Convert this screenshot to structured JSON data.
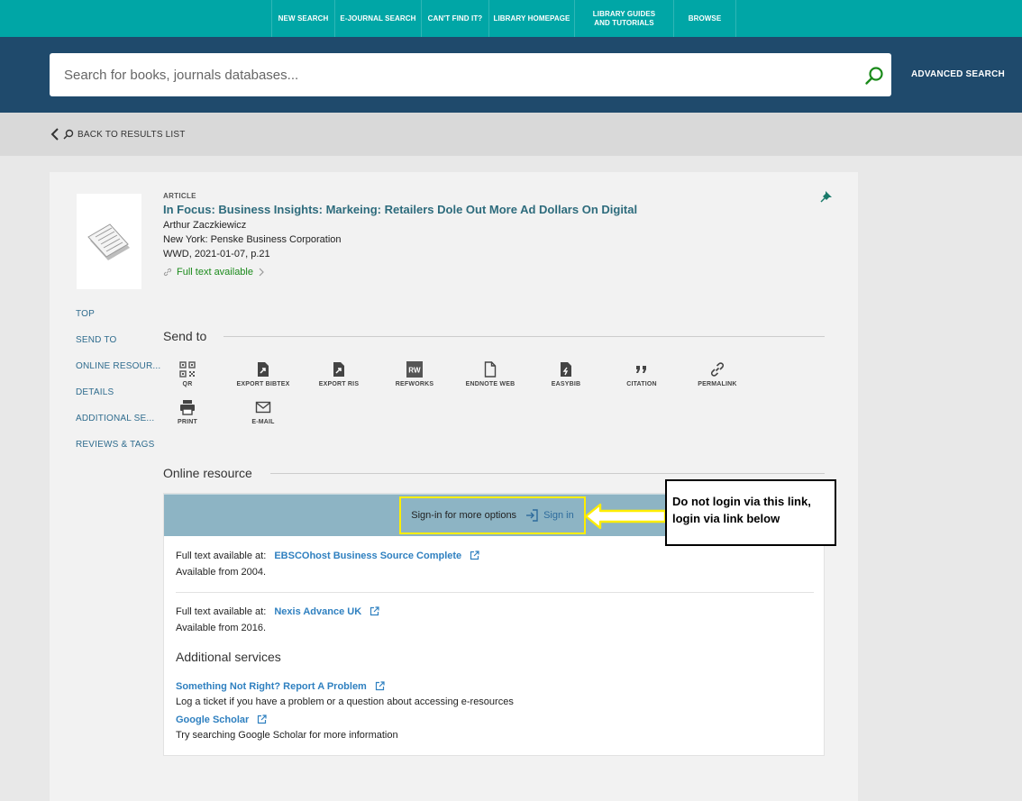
{
  "topnav": {
    "items": [
      "NEW SEARCH",
      "E-JOURNAL SEARCH",
      "CAN'T FIND IT?",
      "LIBRARY HOMEPAGE",
      "LIBRARY GUIDES AND TUTORIALS",
      "BROWSE"
    ]
  },
  "search": {
    "placeholder": "Search for books, journals databases...",
    "advanced_label": "ADVANCED SEARCH"
  },
  "back_label": "BACK TO RESULTS LIST",
  "record": {
    "type": "ARTICLE",
    "title": "In Focus: Business Insights: Markeing: Retailers Dole Out More Ad Dollars On Digital",
    "author": "Arthur Zaczkiewicz",
    "publisher": "New York: Penske Business Corporation",
    "source": "WWD, 2021-01-07, p.21",
    "fulltext": "Full text available"
  },
  "sidenav": [
    "TOP",
    "SEND TO",
    "ONLINE RESOUR...",
    "DETAILS",
    "ADDITIONAL SE...",
    "REVIEWS & TAGS"
  ],
  "sendto": {
    "title": "Send to",
    "items": [
      "QR",
      "EXPORT BIBTEX",
      "EXPORT RIS",
      "REFWORKS",
      "ENDNOTE WEB",
      "EASYBIB",
      "CITATION",
      "PERMALINK",
      "PRINT",
      "E-MAIL"
    ]
  },
  "online": {
    "title": "Online resource",
    "signin_prompt": "Sign-in for more options",
    "signin_link": "Sign in",
    "resources": [
      {
        "label": "Full text available at:",
        "link": "EBSCOhost Business Source Complete",
        "avail": "Available from 2004."
      },
      {
        "label": "Full text available at:",
        "link": "Nexis Advance UK",
        "avail": "Available from 2016."
      }
    ],
    "additional_title": "Additional services",
    "services": [
      {
        "link": "Something Not Right? Report A Problem",
        "desc": "Log a ticket if you have a problem or a question about accessing e-resources"
      },
      {
        "link": "Google Scholar",
        "desc": "Try searching Google Scholar for more information"
      }
    ]
  },
  "callout": {
    "line1": "Do not login via this link,",
    "line2": "login via link below"
  },
  "colors": {
    "teal": "#00a6a6",
    "navy": "#1f4a6c",
    "signbar": "#8db4c4",
    "highlight": "#ffee00"
  }
}
